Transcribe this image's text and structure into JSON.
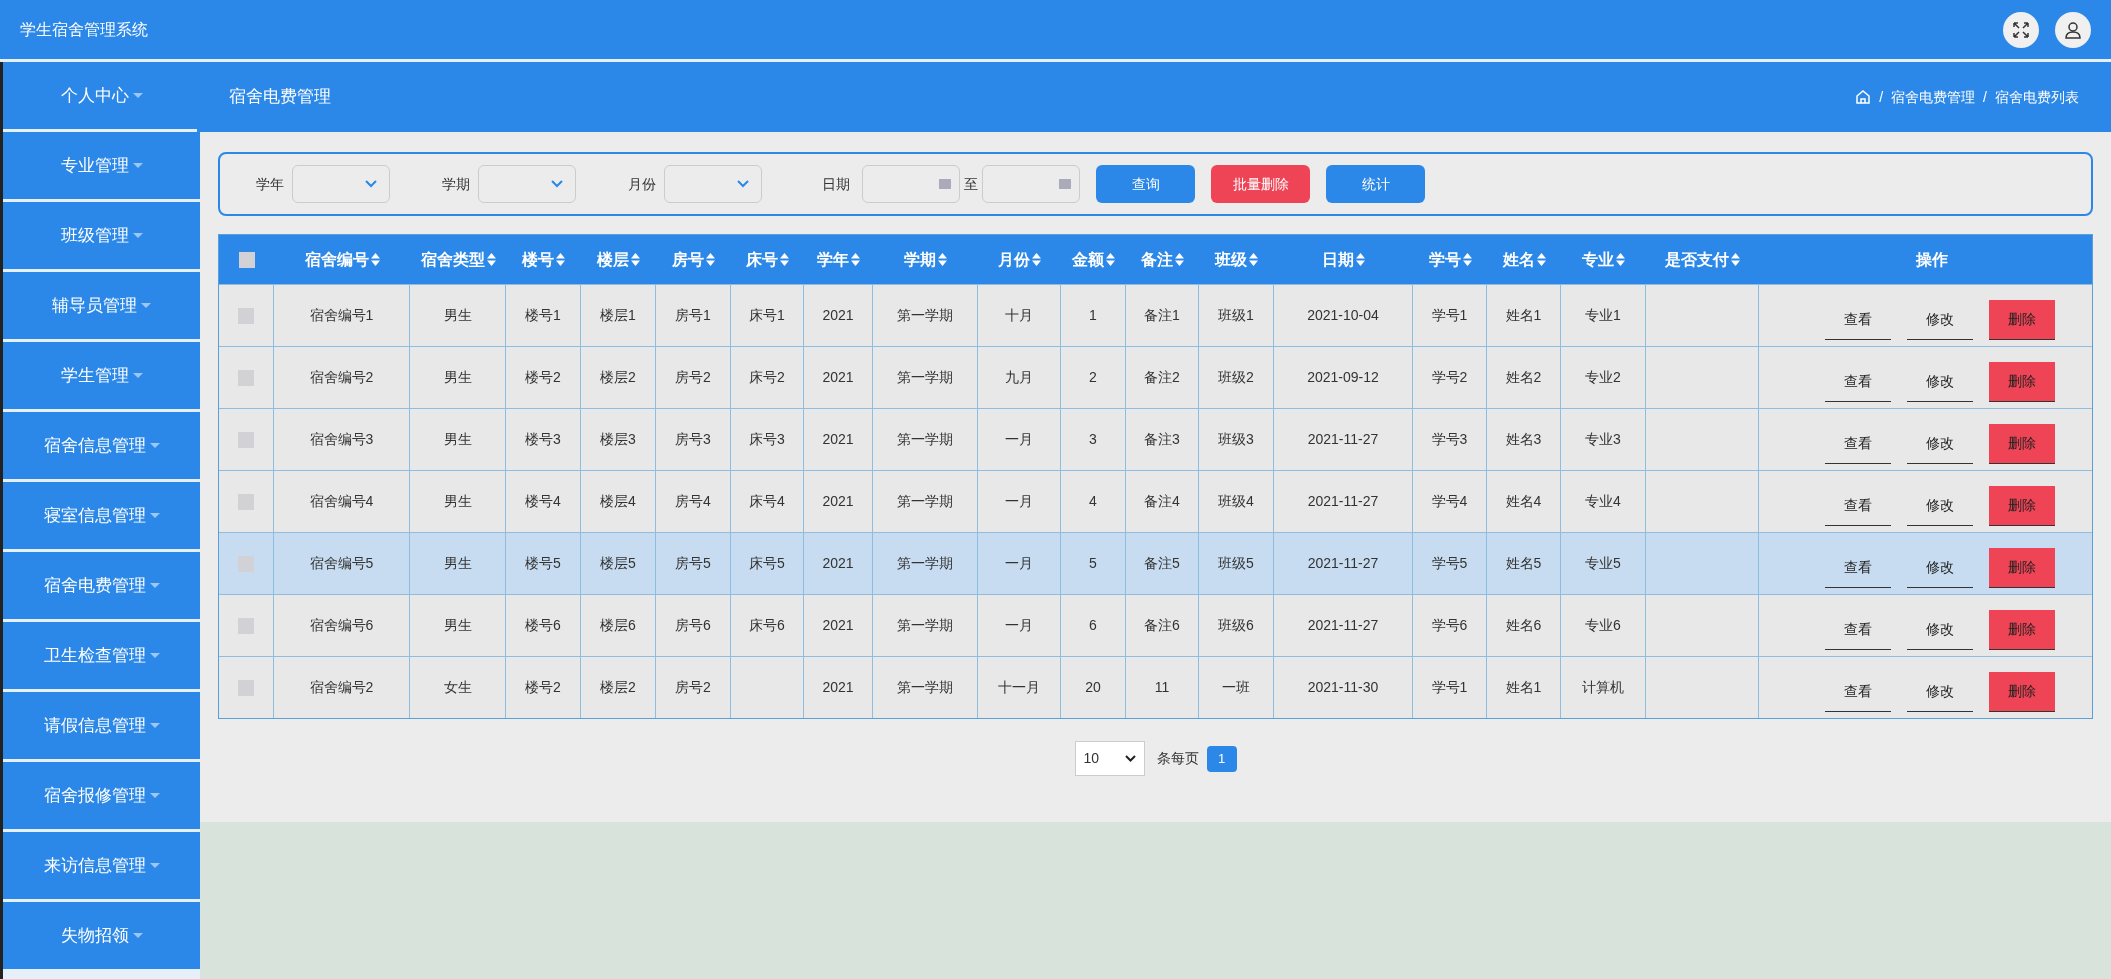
{
  "app_title": "学生宿舍管理系统",
  "sidebar": {
    "items": [
      {
        "label": "个人中心"
      },
      {
        "label": "专业管理"
      },
      {
        "label": "班级管理"
      },
      {
        "label": "辅导员管理"
      },
      {
        "label": "学生管理"
      },
      {
        "label": "宿舍信息管理"
      },
      {
        "label": "寝室信息管理"
      },
      {
        "label": "宿舍电费管理"
      },
      {
        "label": "卫生检查管理"
      },
      {
        "label": "请假信息管理"
      },
      {
        "label": "宿舍报修管理"
      },
      {
        "label": "来访信息管理"
      },
      {
        "label": "失物招领"
      }
    ]
  },
  "page_title": "宿舍电费管理",
  "breadcrumb": [
    {
      "kind": "separator",
      "text": "/"
    },
    {
      "kind": "link",
      "text": "宿舍电费管理"
    },
    {
      "kind": "separator",
      "text": "/"
    },
    {
      "kind": "link",
      "text": "宿舍电费列表"
    }
  ],
  "filters": {
    "selects": [
      {
        "label": "学年"
      },
      {
        "label": "学期"
      },
      {
        "label": "月份"
      }
    ],
    "date_label": "日期",
    "date_separator": "至",
    "buttons": [
      {
        "label": "查询",
        "kind": "primary"
      },
      {
        "label": "批量删除",
        "kind": "danger"
      },
      {
        "label": "统计",
        "kind": "primary"
      }
    ]
  },
  "table": {
    "select_all": {
      "checked": false
    },
    "columns": [
      {
        "label": "宿舍编号",
        "sortable": true
      },
      {
        "label": "宿舍类型",
        "sortable": true
      },
      {
        "label": "楼号",
        "sortable": true
      },
      {
        "label": "楼层",
        "sortable": true
      },
      {
        "label": "房号",
        "sortable": true
      },
      {
        "label": "床号",
        "sortable": true
      },
      {
        "label": "学年",
        "sortable": true
      },
      {
        "label": "学期",
        "sortable": true
      },
      {
        "label": "月份",
        "sortable": true
      },
      {
        "label": "金额",
        "sortable": true
      },
      {
        "label": "备注",
        "sortable": true
      },
      {
        "label": "班级",
        "sortable": true
      },
      {
        "label": "日期",
        "sortable": true
      },
      {
        "label": "学号",
        "sortable": true
      },
      {
        "label": "姓名",
        "sortable": true
      },
      {
        "label": "专业",
        "sortable": true
      },
      {
        "label": "是否支付",
        "sortable": true
      },
      {
        "label": "操作",
        "sortable": false
      }
    ],
    "rows": [
      {
        "selected": false,
        "checked": false,
        "cells": [
          "宿舍编号1",
          "男生",
          "楼号1",
          "楼层1",
          "房号1",
          "床号1",
          "2021",
          "第一学期",
          "十月",
          "1",
          "备注1",
          "班级1",
          "2021-10-04",
          "学号1",
          "姓名1",
          "专业1",
          ""
        ],
        "actions": [
          {
            "label": "查看",
            "kind": "plain"
          },
          {
            "label": "修改",
            "kind": "plain"
          },
          {
            "label": "删除",
            "kind": "danger"
          }
        ]
      },
      {
        "selected": false,
        "checked": false,
        "cells": [
          "宿舍编号2",
          "男生",
          "楼号2",
          "楼层2",
          "房号2",
          "床号2",
          "2021",
          "第一学期",
          "九月",
          "2",
          "备注2",
          "班级2",
          "2021-09-12",
          "学号2",
          "姓名2",
          "专业2",
          ""
        ],
        "actions": [
          {
            "label": "查看",
            "kind": "plain"
          },
          {
            "label": "修改",
            "kind": "plain"
          },
          {
            "label": "删除",
            "kind": "danger"
          }
        ]
      },
      {
        "selected": false,
        "checked": false,
        "cells": [
          "宿舍编号3",
          "男生",
          "楼号3",
          "楼层3",
          "房号3",
          "床号3",
          "2021",
          "第一学期",
          "一月",
          "3",
          "备注3",
          "班级3",
          "2021-11-27",
          "学号3",
          "姓名3",
          "专业3",
          ""
        ],
        "actions": [
          {
            "label": "查看",
            "kind": "plain"
          },
          {
            "label": "修改",
            "kind": "plain"
          },
          {
            "label": "删除",
            "kind": "danger"
          }
        ]
      },
      {
        "selected": false,
        "checked": false,
        "cells": [
          "宿舍编号4",
          "男生",
          "楼号4",
          "楼层4",
          "房号4",
          "床号4",
          "2021",
          "第一学期",
          "一月",
          "4",
          "备注4",
          "班级4",
          "2021-11-27",
          "学号4",
          "姓名4",
          "专业4",
          ""
        ],
        "actions": [
          {
            "label": "查看",
            "kind": "plain"
          },
          {
            "label": "修改",
            "kind": "plain"
          },
          {
            "label": "删除",
            "kind": "danger"
          }
        ]
      },
      {
        "selected": true,
        "checked": false,
        "cells": [
          "宿舍编号5",
          "男生",
          "楼号5",
          "楼层5",
          "房号5",
          "床号5",
          "2021",
          "第一学期",
          "一月",
          "5",
          "备注5",
          "班级5",
          "2021-11-27",
          "学号5",
          "姓名5",
          "专业5",
          ""
        ],
        "actions": [
          {
            "label": "查看",
            "kind": "plain"
          },
          {
            "label": "修改",
            "kind": "plain"
          },
          {
            "label": "删除",
            "kind": "danger"
          }
        ]
      },
      {
        "selected": false,
        "checked": false,
        "cells": [
          "宿舍编号6",
          "男生",
          "楼号6",
          "楼层6",
          "房号6",
          "床号6",
          "2021",
          "第一学期",
          "一月",
          "6",
          "备注6",
          "班级6",
          "2021-11-27",
          "学号6",
          "姓名6",
          "专业6",
          ""
        ],
        "actions": [
          {
            "label": "查看",
            "kind": "plain"
          },
          {
            "label": "修改",
            "kind": "plain"
          },
          {
            "label": "删除",
            "kind": "danger"
          }
        ]
      },
      {
        "selected": false,
        "checked": false,
        "cells": [
          "宿舍编号2",
          "女生",
          "楼号2",
          "楼层2",
          "房号2",
          "",
          "2021",
          "第一学期",
          "十一月",
          "20",
          "11",
          "一班",
          "2021-11-30",
          "学号1",
          "姓名1",
          "计算机",
          ""
        ],
        "actions": [
          {
            "label": "查看",
            "kind": "plain"
          },
          {
            "label": "修改",
            "kind": "plain"
          },
          {
            "label": "删除",
            "kind": "danger"
          }
        ]
      }
    ]
  },
  "pagination": {
    "page_size": "10",
    "page_size_label": "条每页",
    "pages": [
      {
        "label": "1",
        "selected": true
      }
    ]
  }
}
